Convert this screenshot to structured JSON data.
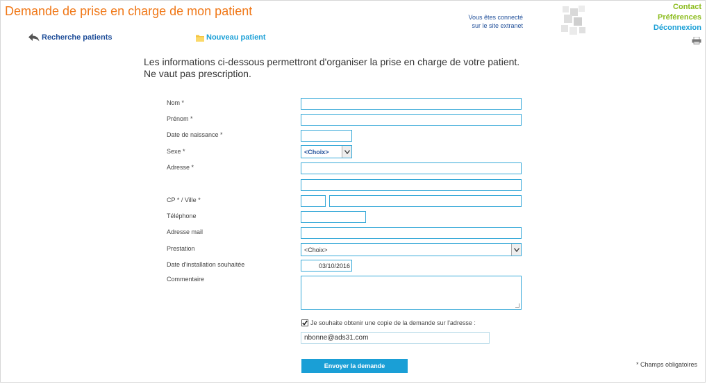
{
  "header": {
    "title": "Demande de prise en charge de mon patient",
    "connected_line1": "Vous êtes connecté",
    "connected_line2": "sur le site extranet",
    "contact": "Contact",
    "preferences": "Préférences",
    "logout": "Déconnexion"
  },
  "nav": {
    "search_patients": "Recherche patients",
    "new_patient": "Nouveau patient"
  },
  "intro": {
    "line1": "Les informations ci-dessous permettront d'organiser la prise en charge de votre patient.",
    "line2": "Ne vaut pas prescription."
  },
  "form": {
    "labels": {
      "nom": "Nom *",
      "prenom": "Prénom *",
      "date_naissance": "Date de naissance *",
      "sexe": "Sexe *",
      "adresse": "Adresse *",
      "cp_ville": "CP * / Ville *",
      "telephone": "Téléphone",
      "email": "Adresse mail",
      "prestation": "Prestation",
      "date_installation": "Date d'installation souhaitée",
      "commentaire": "Commentaire"
    },
    "values": {
      "nom": "",
      "prenom": "",
      "date_naissance": "",
      "sexe": "<Choix>",
      "adresse1": "",
      "adresse2": "",
      "cp": "",
      "ville": "",
      "telephone": "",
      "email": "",
      "prestation": "<Choix>",
      "date_installation": "03/10/2016",
      "commentaire": "",
      "copy_email": "nbonne@ads31.com"
    },
    "copy_checked": true,
    "copy_label": "Je souhaite obtenir une copie de la demande sur l'adresse :",
    "submit": "Envoyer la demande",
    "required_note": "* Champs obligatoires"
  },
  "colors": {
    "title": "#f07818",
    "accent": "#1a9fd6",
    "link_green": "#8cbc1e",
    "navy": "#1f4e99"
  }
}
